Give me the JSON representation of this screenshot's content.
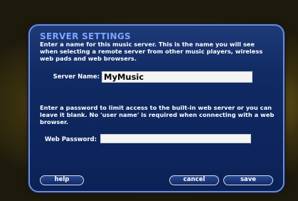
{
  "dialog": {
    "title": "SERVER SETTINGS",
    "description_name": "Enter a name for this music server.  This is the name you will see when selecting a remote server from other music players, wireless web pads and web browsers.",
    "server_name_label": "Server Name:",
    "server_name_value": "MyMusic",
    "description_password": "Enter a password to limit access to the built-in web server or you can leave it blank.  No 'user name' is required when connecting with a web browser.",
    "web_password_label": "Web Password:",
    "web_password_value": "",
    "buttons": {
      "help": "help",
      "cancel": "cancel",
      "save": "save"
    }
  },
  "colors": {
    "panel": "#0b2258",
    "title": "#7fa6ff",
    "background_glow": "#e8c24a"
  }
}
